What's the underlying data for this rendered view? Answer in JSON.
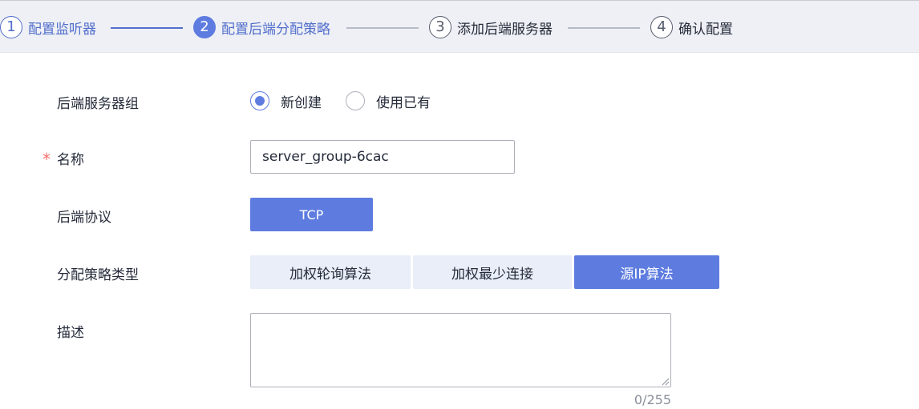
{
  "steps": [
    {
      "num": "1",
      "label": "配置监听器",
      "state": "done"
    },
    {
      "num": "2",
      "label": "配置后端分配策略",
      "state": "active"
    },
    {
      "num": "3",
      "label": "添加后端服务器",
      "state": "todo"
    },
    {
      "num": "4",
      "label": "确认配置",
      "state": "todo"
    }
  ],
  "form": {
    "server_group": {
      "label": "后端服务器组",
      "options": [
        "新创建",
        "使用已有"
      ],
      "selected": "新创建"
    },
    "name": {
      "required_mark": "*",
      "label": "名称",
      "value": "server_group-6cac"
    },
    "protocol": {
      "label": "后端协议",
      "value": "TCP"
    },
    "algorithm": {
      "label": "分配策略类型",
      "options": [
        "加权轮询算法",
        "加权最少连接",
        "源IP算法"
      ],
      "selected": "源IP算法"
    },
    "description": {
      "label": "描述",
      "value": "",
      "counter": "0/255"
    }
  },
  "colors": {
    "accent": "#5e7ce0",
    "header_bg": "#eef0f5",
    "segment_off_bg": "#e9eef9",
    "required": "#f66f6a"
  }
}
